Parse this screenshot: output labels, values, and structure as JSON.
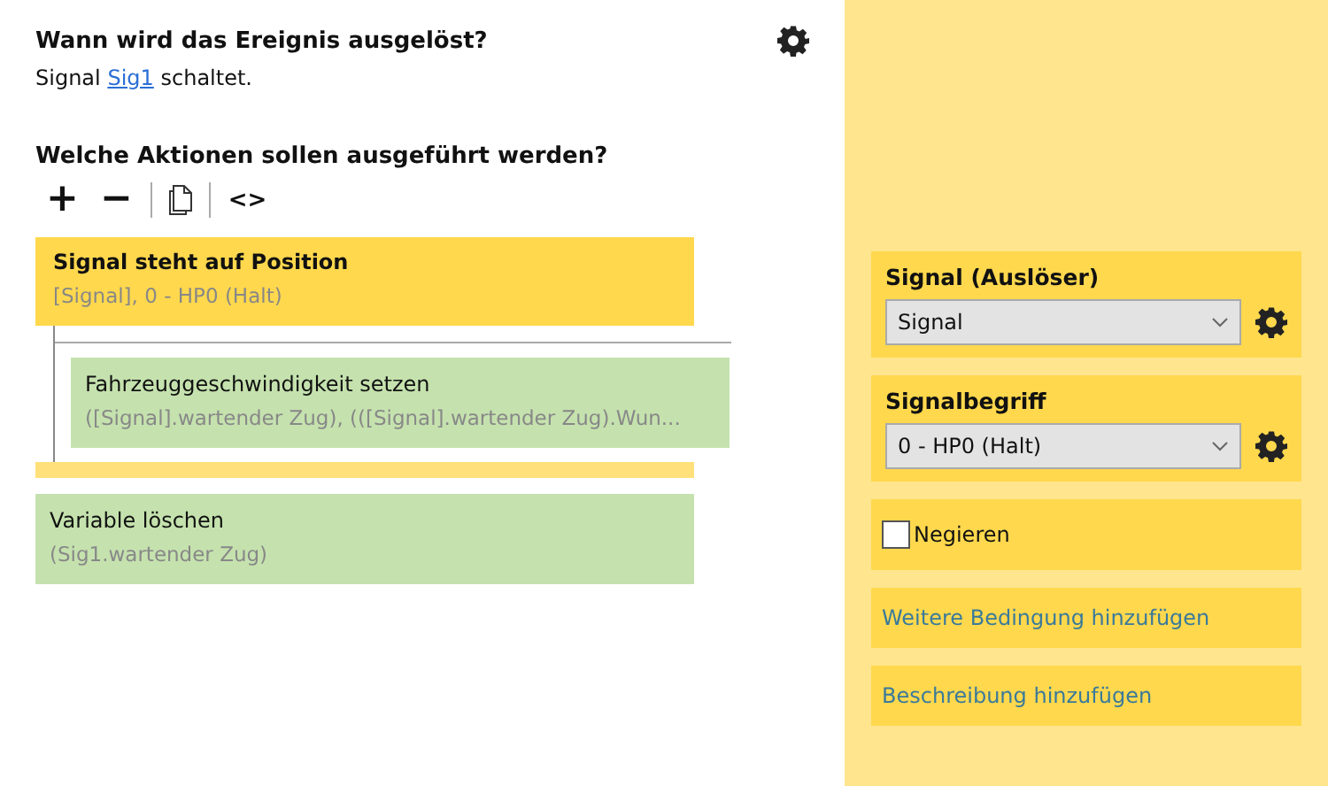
{
  "trigger": {
    "heading": "Wann wird das Ereignis ausgelöst?",
    "prefix": "Signal",
    "link": "Sig1",
    "suffix": "schaltet."
  },
  "actions_heading": "Welche Aktionen sollen ausgeführt werden?",
  "toolbar": [
    "+",
    "−",
    "<>"
  ],
  "actions": [
    {
      "kind": "condition",
      "title": "Signal steht auf Position",
      "detail": "[Signal], 0 - HP0 (Halt)",
      "children": [
        {
          "kind": "action",
          "title": "Fahrzeuggeschwindigkeit setzen",
          "detail": "([Signal].wartender Zug), (([Signal].wartender Zug).Wun..."
        }
      ]
    },
    {
      "kind": "action",
      "title": "Variable löschen",
      "detail": "(Sig1.wartender Zug)"
    }
  ],
  "properties": [
    {
      "kind": "select",
      "label": "Signal (Auslöser)",
      "value": "Signal"
    },
    {
      "kind": "select",
      "label": "Signalbegriff",
      "value": "0 - HP0 (Halt)"
    },
    {
      "kind": "checkbox",
      "label": "Negieren",
      "checked": false
    },
    {
      "kind": "link",
      "label": "Weitere Bedingung hinzufügen"
    },
    {
      "kind": "link",
      "label": "Beschreibung hinzufügen"
    }
  ]
}
